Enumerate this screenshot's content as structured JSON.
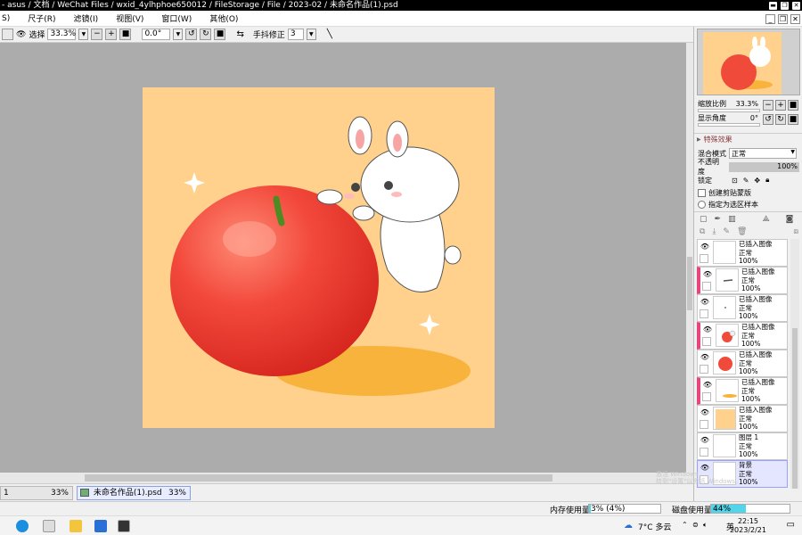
{
  "window": {
    "title": "- asus / 文档 / WeChat Files / wxid_4ylhphoe650012 / FileStorage / File / 2023-02 / 未命名作品(1).psd"
  },
  "menu": {
    "items": [
      "S)",
      "尺子(R)",
      "滤镜(I)",
      "视图(V)",
      "窗口(W)",
      "其他(O)"
    ]
  },
  "toolbar": {
    "select_label": "选择",
    "zoom_value": "33.3%",
    "rotation_value": "0.0°",
    "stabilizer_label": "手抖修正",
    "stabilizer_value": "3"
  },
  "navigator": {
    "zoom_label": "缩放比例",
    "zoom_value": "33.3%",
    "angle_label": "显示角度",
    "angle_value": "0°"
  },
  "layer_props": {
    "section_title": "特殊效果",
    "blend_label": "混合模式",
    "blend_value": "正常",
    "opacity_label": "不透明度",
    "opacity_value": "100%",
    "lock_label": "锁定",
    "clip_checkbox": "创建剪贴蒙版",
    "sample_radio": "指定为选区样本"
  },
  "layers": [
    {
      "name": "已插入图像",
      "mode": "正常",
      "opacity": "100%",
      "clip": false,
      "selected": false,
      "thumb": "blank"
    },
    {
      "name": "已插入图像",
      "mode": "正常",
      "opacity": "100%",
      "clip": true,
      "selected": false,
      "thumb": "stem"
    },
    {
      "name": "已插入图像",
      "mode": "正常",
      "opacity": "100%",
      "clip": false,
      "selected": false,
      "thumb": "dot"
    },
    {
      "name": "已插入图像",
      "mode": "正常",
      "opacity": "100%",
      "clip": true,
      "selected": false,
      "thumb": "apple-small"
    },
    {
      "name": "已插入图像",
      "mode": "正常",
      "opacity": "100%",
      "clip": false,
      "selected": false,
      "thumb": "red-circle"
    },
    {
      "name": "已插入图像",
      "mode": "正常",
      "opacity": "100%",
      "clip": true,
      "selected": false,
      "thumb": "shadow"
    },
    {
      "name": "已插入图像",
      "mode": "正常",
      "opacity": "100%",
      "clip": false,
      "selected": false,
      "thumb": "orange"
    },
    {
      "name": "图层 1",
      "mode": "正常",
      "opacity": "100%",
      "clip": false,
      "selected": false,
      "thumb": "blank"
    },
    {
      "name": "背景",
      "mode": "正常",
      "opacity": "100%",
      "clip": false,
      "selected": true,
      "thumb": "blank"
    }
  ],
  "doc_tabs": [
    {
      "label": "1",
      "zoom": "33%"
    },
    {
      "label": "未命名作品(1).psd",
      "zoom": "33%"
    }
  ],
  "watermark": {
    "line1": "激活 Windows",
    "line2": "转到\"设置\"以激活 Windows。"
  },
  "status": {
    "memory_label": "内存使用量",
    "memory_value": "3% (4%)",
    "memory_fraction": 0.03,
    "disk_label": "磁盘使用量",
    "disk_value": "44%",
    "disk_fraction": 0.44
  },
  "taskbar": {
    "weather": "7°C 多云",
    "ime": "英",
    "time": "22:15",
    "date": "2023/2/21"
  }
}
